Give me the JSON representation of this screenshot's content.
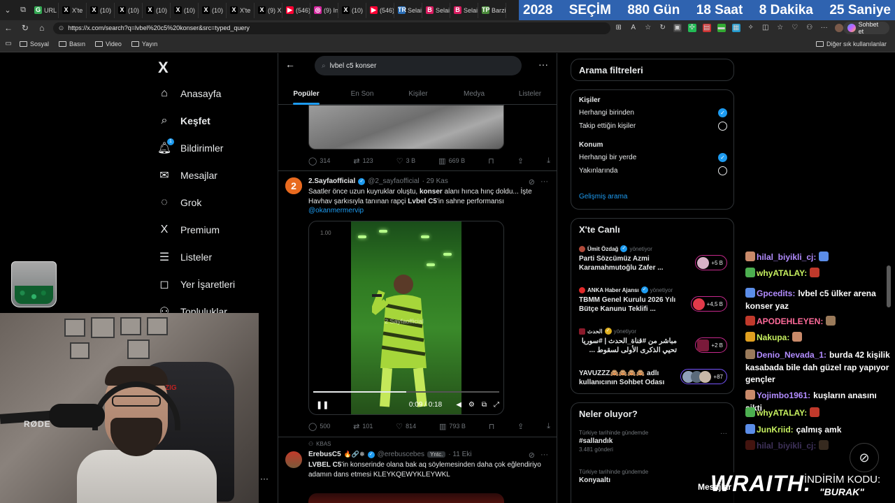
{
  "browser": {
    "tabs": [
      {
        "label": "URL",
        "fav": "G",
        "color": "#34a853"
      },
      {
        "label": "X'te",
        "fav": "X",
        "color": "#000000"
      },
      {
        "label": "(10)",
        "fav": "X",
        "color": "#000000"
      },
      {
        "label": "(10)",
        "fav": "X",
        "color": "#000000"
      },
      {
        "label": "(10)",
        "fav": "X",
        "color": "#000000"
      },
      {
        "label": "(10)",
        "fav": "X",
        "color": "#000000"
      },
      {
        "label": "(10)",
        "fav": "X",
        "color": "#000000"
      },
      {
        "label": "X'te",
        "fav": "X",
        "color": "#000000"
      },
      {
        "label": "(9) X",
        "fav": "X",
        "color": "#000000"
      },
      {
        "label": "(546)",
        "fav": "▶",
        "color": "#ff0033"
      },
      {
        "label": "(9) In",
        "fav": "◎",
        "color": "#d6249f"
      },
      {
        "label": "(10)",
        "fav": "X",
        "color": "#000000"
      },
      {
        "label": "(546)",
        "fav": "▶",
        "color": "#ff0033"
      },
      {
        "label": "Selai",
        "fav": "TR",
        "color": "#2a6db5"
      },
      {
        "label": "Selai",
        "fav": "B",
        "color": "#d81b60"
      },
      {
        "label": "Selai",
        "fav": "B",
        "color": "#d81b60"
      },
      {
        "label": "Barzi",
        "fav": "TP",
        "color": "#4a8a3a"
      }
    ],
    "countdown": [
      "2028",
      "SEÇİM",
      "880 Gün",
      "18 Saat",
      "8 Dakika",
      "25 Saniye"
    ],
    "url": "https://x.com/search?q=lvbel%20c5%20konser&src=typed_query",
    "chat_button": "Sohbet et",
    "bookmarks": [
      "Sosyal",
      "Basın",
      "Video",
      "Yayın"
    ],
    "other_bookmarks": "Diğer sık kullanılanlar"
  },
  "nav": {
    "logo": "X",
    "items": [
      {
        "label": "Anasayfa",
        "icon": "⌂"
      },
      {
        "label": "Keşfet",
        "icon": "⌕"
      },
      {
        "label": "Bildirimler",
        "icon": "♫",
        "badge": "1"
      },
      {
        "label": "Mesajlar",
        "icon": "✉"
      },
      {
        "label": "Grok",
        "icon": "◌"
      },
      {
        "label": "Premium",
        "icon": "X"
      },
      {
        "label": "Listeler",
        "icon": "☰"
      },
      {
        "label": "Yer İşaretleri",
        "icon": "◻"
      },
      {
        "label": "Topluluklar",
        "icon": "⚇"
      }
    ]
  },
  "search": {
    "query": "lvbel c5 konser",
    "tabs": [
      "Popüler",
      "En Son",
      "Kişiler",
      "Medya",
      "Listeler"
    ]
  },
  "tweets": {
    "first_stats": {
      "replies": "314",
      "reposts": "123",
      "likes": "3 B",
      "views": "669 B"
    },
    "main": {
      "name": "2.Sayfaofficial",
      "handle": "@2_sayfaofficial",
      "time": "· 29 Kas",
      "text_1": "Saatler önce uzun kuyruklar oluştu, ",
      "text_b1": "konser",
      "text_2": " alanı hınca hınç doldu... İşte Havhav şarkısıyla tanınan rapçi ",
      "text_b2": "Lvbel C5",
      "text_3": "'in sahne performansı",
      "mention": "@okanmermervip",
      "video_time": "0:09 / 0:18",
      "video_rate": "1.00",
      "video_watermark": "2 Sayfaofficial",
      "progress": 0.5,
      "stats": {
        "replies": "500",
        "reposts": "101",
        "likes": "814",
        "views": "793 B"
      }
    },
    "next": {
      "context": "KBAS",
      "name": "ErebusC5",
      "handle": "@erebuscebes",
      "tag": "Yntc.",
      "time": "· 11 Eki",
      "text_b": "LVBEL C5",
      "text_rest": "'in konserinde olana bak aq söylemesinden daha çok eğlendiriyo adamın dans etmesi KLEYKQEWYKLEYWKL"
    }
  },
  "filters": {
    "title": "Arama filtreleri",
    "people_title": "Kişiler",
    "people_options": [
      {
        "label": "Herhangi birinden",
        "on": true
      },
      {
        "label": "Takip ettiğin kişiler",
        "on": false
      }
    ],
    "location_title": "Konum",
    "location_options": [
      {
        "label": "Herhangi bir yerde",
        "on": true
      },
      {
        "label": "Yakınlarında",
        "on": false
      }
    ],
    "advanced": "Gelişmiş arama"
  },
  "live": {
    "title": "X'te Canlı",
    "items": [
      {
        "host": "Ümit Özdağ",
        "role": "yönetiyor",
        "title": "Parti Sözcümüz Azmi Karamahmutoğlu Zafer ...",
        "count": "+5 B",
        "color": "#c6298c"
      },
      {
        "host": "ANKA Haber Ajansı",
        "role": "yönetiyor",
        "title": "TBMM Genel Kurulu 2026 Yılı Bütçe Kanunu Teklifi ...",
        "count": "+4,5 B",
        "color": "#c6298c"
      },
      {
        "host": "الحدث",
        "role": "yönetiyor",
        "title": "مباشر من #قناة_الحدث | #سوريا تحيي الذكرى الأولى لسقوط ...",
        "count": "+2 B",
        "color": "#c6298c"
      },
      {
        "host": "",
        "role": "",
        "title": "YAVUZZZ🙈🙈🙈🙈 adlı kullanıcının Sohbet Odası",
        "count": "+87",
        "color": "#7856ff"
      }
    ]
  },
  "trends": {
    "title": "Neler oluyor?",
    "items": [
      {
        "context": "Türkiye tarihinde gündemde",
        "name": "#sallandık",
        "count": "3.481 gönderi"
      },
      {
        "context": "Türkiye tarihinde gündemde",
        "name": "Konyaaltı",
        "count": ""
      }
    ]
  },
  "chat": [
    {
      "user": "hilal_biyikli_cj:",
      "user_color": "#b28cff",
      "text": ""
    },
    {
      "user": "whyATALAY:",
      "user_color": "#c7f060",
      "text": ""
    },
    {
      "user": "Gpcedits:",
      "user_color": "#b28cff",
      "text": "lvbel c5 ülker arena konser yaz"
    },
    {
      "user": "APODEHLEYEN:",
      "user_color": "#ff6b9a",
      "text": ""
    },
    {
      "user": "Nakupa:",
      "user_color": "#c7f060",
      "text": ""
    },
    {
      "user": "Denio_Nevada_1:",
      "user_color": "#b28cff",
      "text": "burda 42 kişilik kasabada bile dah güzel rap yapıyor gençler"
    },
    {
      "user": "Yojimbo1961:",
      "user_color": "#b28cff",
      "text": "kuşların anasını sikti"
    },
    {
      "user": "whyATALAY:",
      "user_color": "#c7f060",
      "text": ""
    },
    {
      "user": "JunKriid:",
      "user_color": "#c7f060",
      "text": "çalmış amk"
    },
    {
      "user": "hilal_biyikli_cj:",
      "user_color": "#b28cff",
      "text": ""
    }
  ],
  "overlay": {
    "webcam_brand": "RØDE",
    "chair_logo": "ZIG",
    "messages_label": "Mesajlar",
    "sponsor": "WRAITH.",
    "promo_title": "İNDİRİM KODU:",
    "promo_code": "\"BURAK\""
  }
}
